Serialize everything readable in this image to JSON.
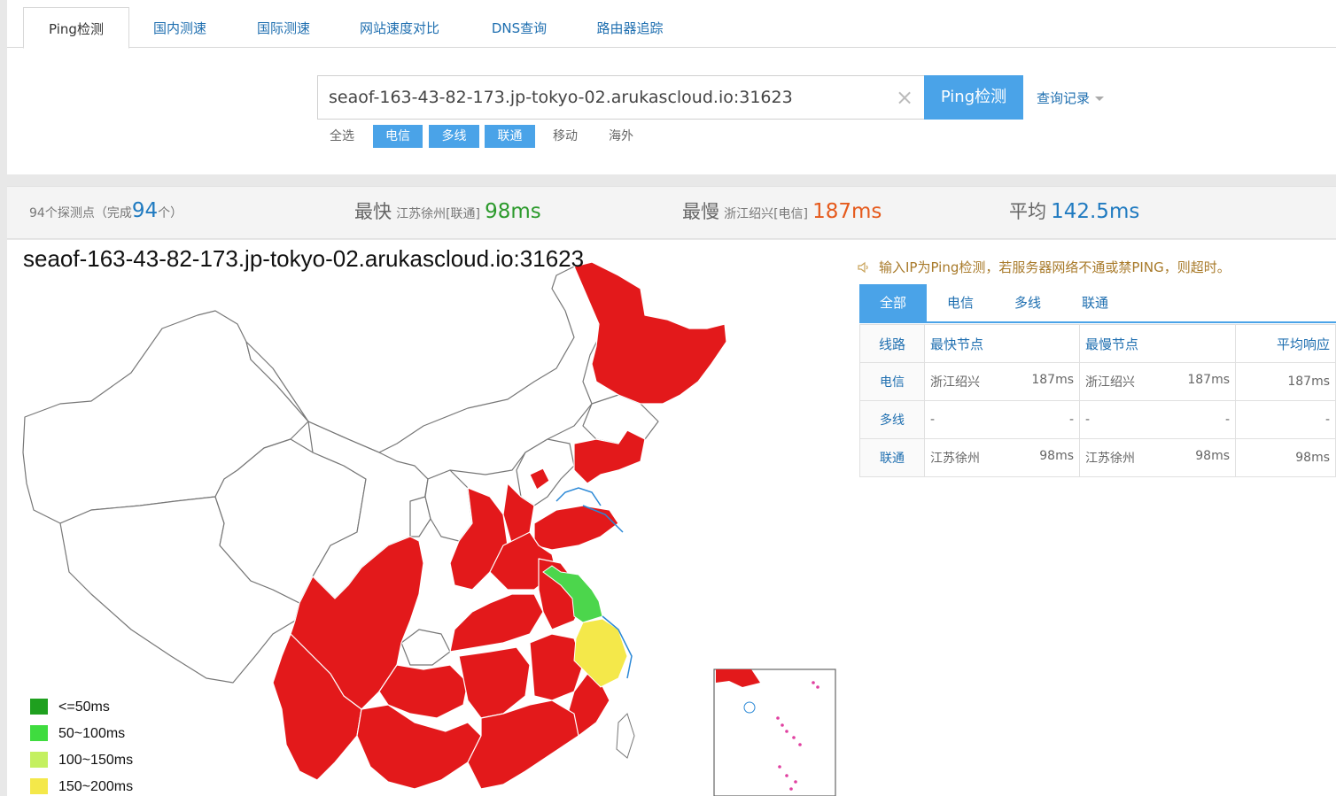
{
  "tabs": [
    {
      "label": "Ping检测",
      "active": true
    },
    {
      "label": "国内测速"
    },
    {
      "label": "国际测速"
    },
    {
      "label": "网站速度对比"
    },
    {
      "label": "DNS查询"
    },
    {
      "label": "路由器追踪"
    }
  ],
  "search": {
    "value": "seaof-163-43-82-173.jp-tokyo-02.arukascloud.io:31623",
    "clear_icon": "×",
    "button_label": "Ping检测",
    "history_label": "查询记录"
  },
  "filters": [
    {
      "label": "全选",
      "selected": false
    },
    {
      "label": "电信",
      "selected": true
    },
    {
      "label": "多线",
      "selected": true
    },
    {
      "label": "联通",
      "selected": true
    },
    {
      "label": "移动",
      "selected": false
    },
    {
      "label": "海外",
      "selected": false
    }
  ],
  "summary": {
    "probes_prefix": "94个探测点（完成",
    "probes_done": "94",
    "probes_suffix": "个）",
    "fastest_label": "最快",
    "fastest_location": "江苏徐州[联通]",
    "fastest_value": "98ms",
    "slowest_label": "最慢",
    "slowest_location": "浙江绍兴[电信]",
    "slowest_value": "187ms",
    "average_label": "平均",
    "average_value": "142.5ms",
    "colors": {
      "fast": "#2c9a2c",
      "slow": "#e55a1c",
      "avg": "#1f7ac0"
    }
  },
  "map": {
    "title": "seaof-163-43-82-173.jp-tokyo-02.arukascloud.io:31623",
    "legend": [
      {
        "label": "<=50ms",
        "color": "#1fa01f"
      },
      {
        "label": "50~100ms",
        "color": "#3fdc3f"
      },
      {
        "label": "100~150ms",
        "color": "#c4f060"
      },
      {
        "label": "150~200ms",
        "color": "#f4e84a"
      }
    ],
    "colors": {
      "red": "#e3191b",
      "green": "#4cd64c",
      "yellow": "#f4e84a"
    }
  },
  "notice": "输入IP为Ping检测，若服务器网络不通或禁PING，则超时。",
  "result_tabs": [
    {
      "label": "全部",
      "active": true
    },
    {
      "label": "电信"
    },
    {
      "label": "多线"
    },
    {
      "label": "联通"
    }
  ],
  "table": {
    "headers": {
      "line": "线路",
      "fastest": "最快节点",
      "slowest": "最慢节点",
      "avg": "平均响应"
    },
    "rows": [
      {
        "line": "电信",
        "fast_node": "浙江绍兴",
        "fast_ms": "187ms",
        "slow_node": "浙江绍兴",
        "slow_ms": "187ms",
        "avg": "187ms"
      },
      {
        "line": "多线",
        "fast_node": "-",
        "fast_ms": "-",
        "slow_node": "-",
        "slow_ms": "-",
        "avg": "-"
      },
      {
        "line": "联通",
        "fast_node": "江苏徐州",
        "fast_ms": "98ms",
        "slow_node": "江苏徐州",
        "slow_ms": "98ms",
        "avg": "98ms"
      }
    ]
  }
}
